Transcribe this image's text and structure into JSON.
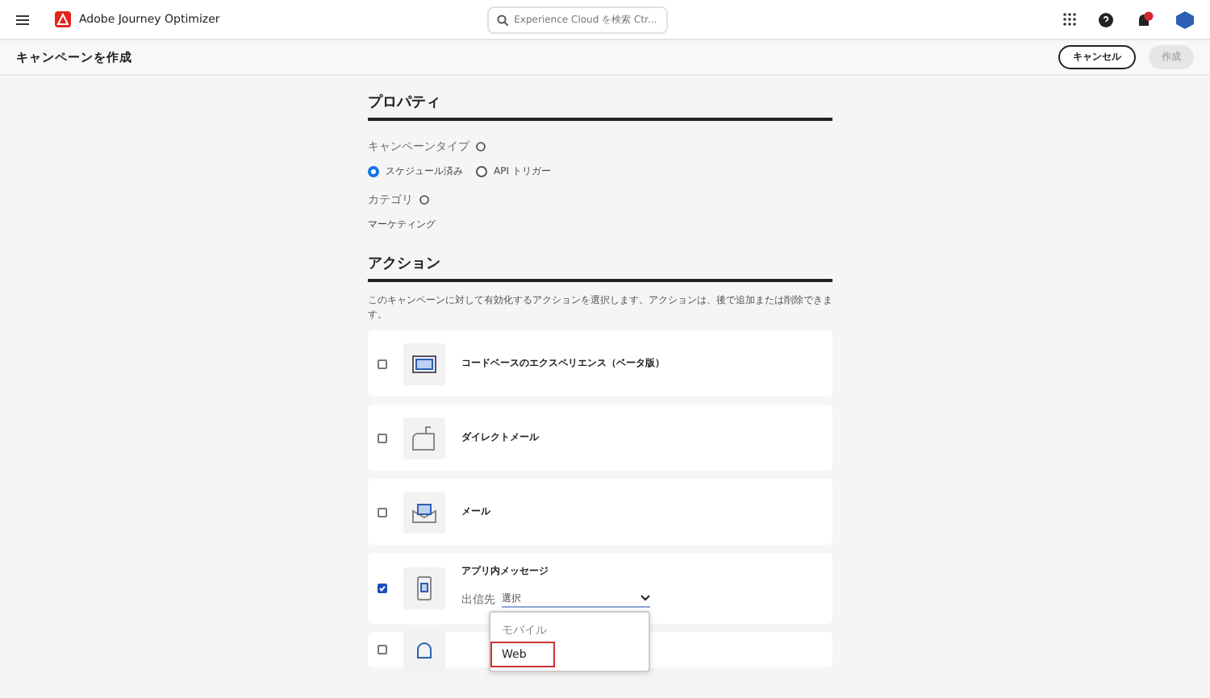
{
  "app": {
    "name": "Adobe Journey Optimizer",
    "search_placeholder": "Experience Cloud を検索 Ctr..."
  },
  "page": {
    "title": "キャンペーンを作成",
    "cancel": "キャンセル",
    "create": "作成",
    "create_disabled": true
  },
  "properties": {
    "heading": "プロパティ",
    "type_label": "キャンペーンタイプ",
    "type_options": [
      {
        "label": "スケジュール済み",
        "selected": true
      },
      {
        "label": "API トリガー",
        "selected": false
      }
    ],
    "category_label": "カテゴリ",
    "category_value": "マーケティング"
  },
  "actions": {
    "heading": "アクション",
    "description": "このキャンペーンに対して有効化するアクションを選択します。アクションは、後で追加または削除できます。",
    "items": [
      {
        "kind": "code",
        "label": "コードベースのエクスペリエンス（ベータ版）",
        "checked": false
      },
      {
        "kind": "mail",
        "label": "ダイレクトメール",
        "checked": false
      },
      {
        "kind": "email",
        "label": "メール",
        "checked": false
      },
      {
        "kind": "inapp",
        "label": "アプリ内メッセージ",
        "checked": true,
        "target_label": "出信先",
        "target_placeholder": "選択",
        "options": [
          {
            "label": "モバイル",
            "disabled": true,
            "highlighted": false
          },
          {
            "label": "Web",
            "disabled": false,
            "highlighted": true
          }
        ]
      },
      {
        "kind": "push",
        "checked": false
      }
    ]
  }
}
